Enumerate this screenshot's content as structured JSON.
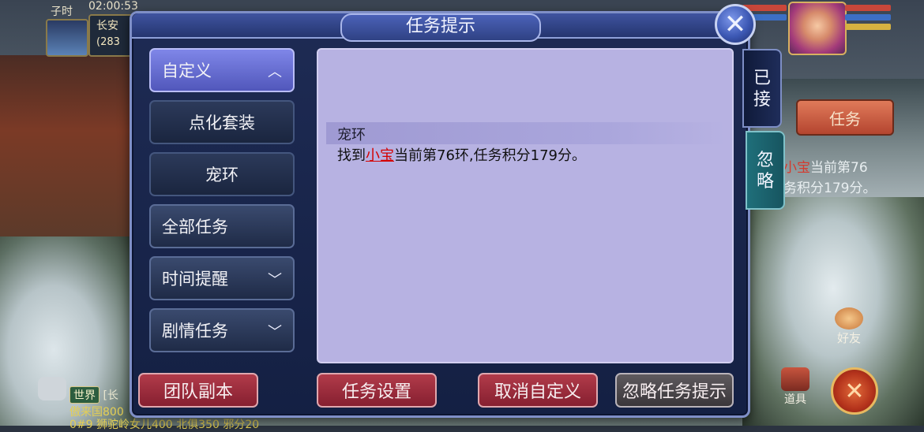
{
  "status": {
    "period": "子时",
    "clock": "02:00",
    "seconds": "53"
  },
  "city": {
    "name": "长安",
    "coords": "(283"
  },
  "dialog": {
    "title": "任务提示",
    "close_symbol": "✕",
    "categories": [
      {
        "label": "自定义",
        "state": "expanded"
      },
      {
        "label": "点化套装",
        "state": "sub"
      },
      {
        "label": "宠环",
        "state": "sub"
      },
      {
        "label": "全部任务",
        "state": "plain"
      },
      {
        "label": "时间提醒",
        "state": "collapsed"
      },
      {
        "label": "剧情任务",
        "state": "collapsed"
      }
    ],
    "content": {
      "heading": "宠环",
      "text_prefix": "找到",
      "npc_name": "小宝",
      "text_suffix": "当前第76环,任务积分179分。"
    },
    "side_tabs": {
      "accepted": "已\n接",
      "ignored": "忽\n略"
    },
    "buttons": {
      "team_dungeon": "团队副本",
      "task_settings": "任务设置",
      "cancel_custom": "取消自定义",
      "ignore_tip": "忽略任务提示"
    }
  },
  "hud": {
    "task_button": "任务",
    "tracker": {
      "npc": "小宝",
      "line1_suffix": "当前第76",
      "line2": "务积分179分。"
    },
    "friend_label": "好友",
    "bag_label": "道具",
    "chat": {
      "channel": "世界",
      "channel_suffix": "[长",
      "line1": "傲来国800",
      "line2": "0#9 狮驼岭女儿400 北俱350 邪分20"
    }
  },
  "colors": {
    "npc_link": "#d40000",
    "accent": "#5157bb",
    "panel_bg": "#b7b2e2"
  }
}
